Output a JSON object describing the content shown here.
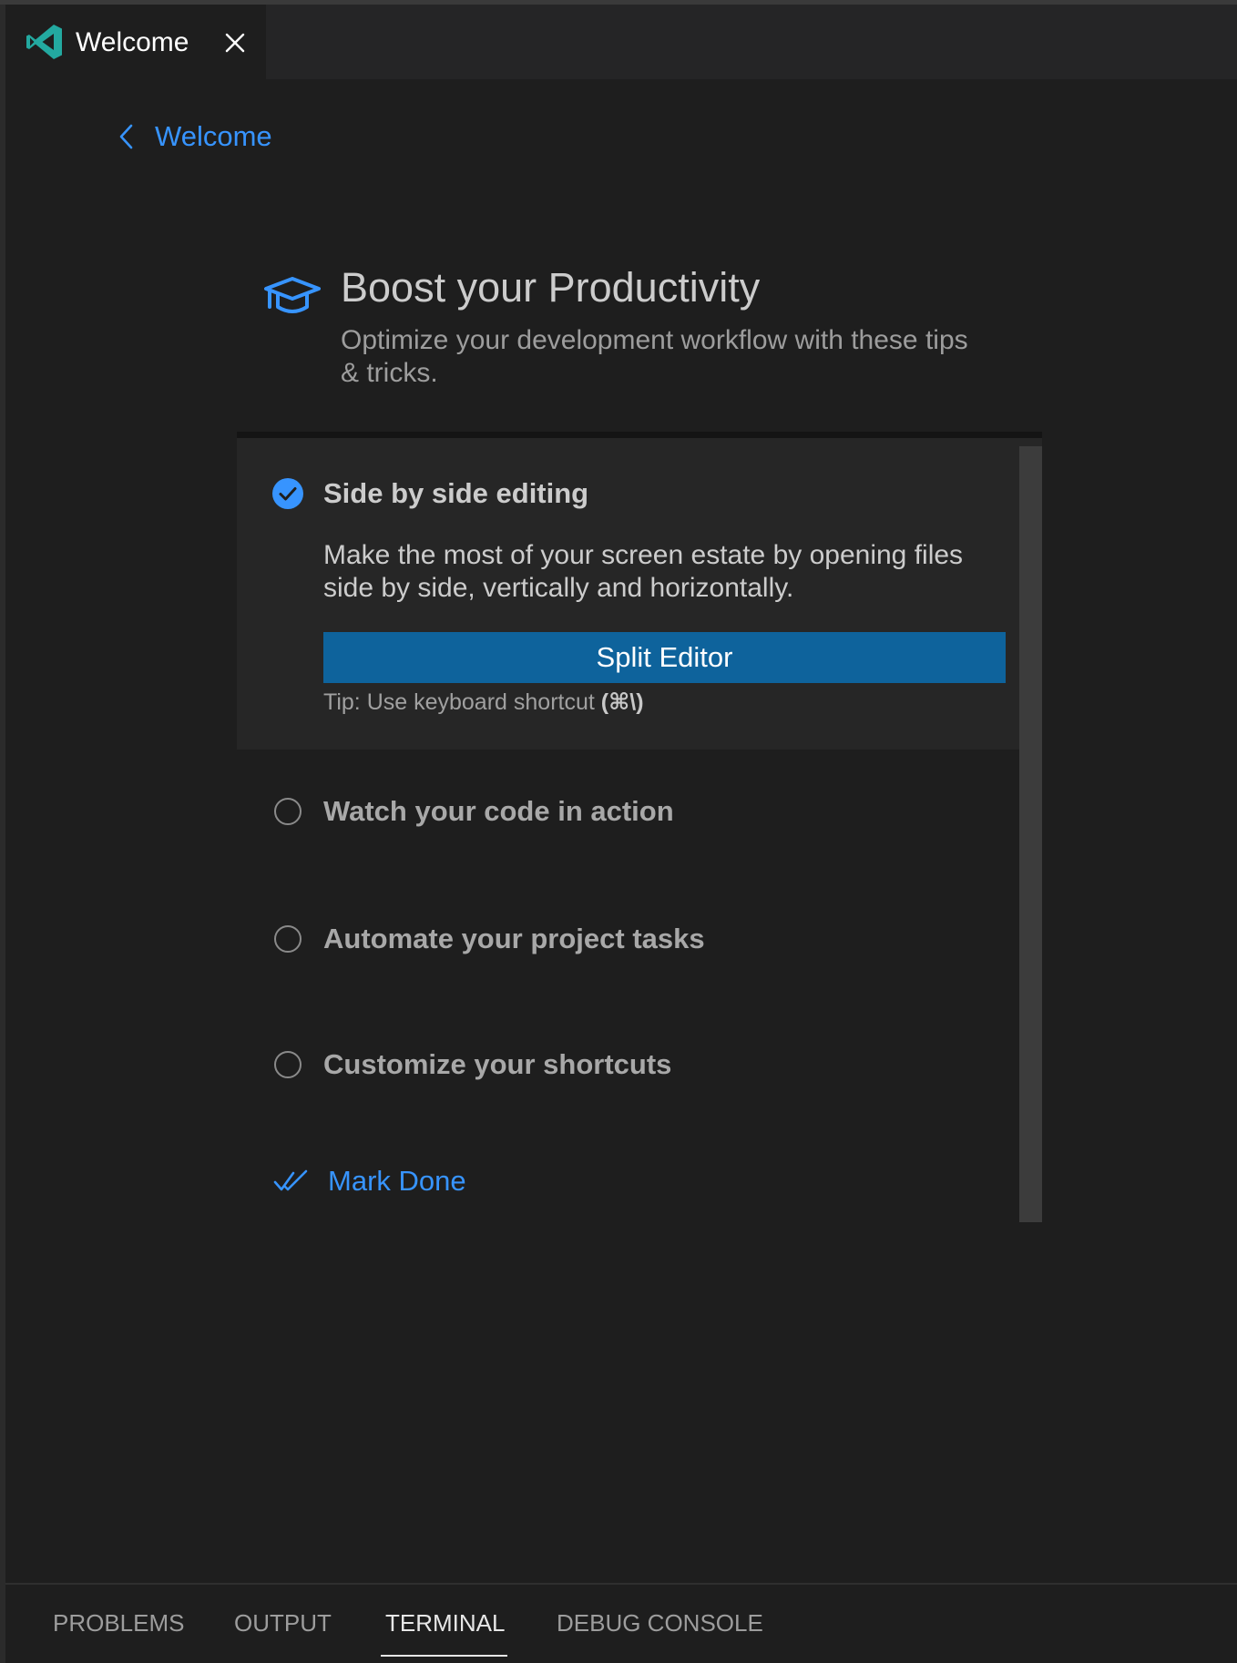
{
  "tab": {
    "label": "Welcome"
  },
  "back": {
    "label": "Welcome"
  },
  "header": {
    "title": "Boost your Productivity",
    "subtitle": "Optimize your development workflow with these tips & tricks."
  },
  "steps": [
    {
      "title": "Side by side editing",
      "done": true,
      "description": "Make the most of your screen estate by opening files side by side, vertically and horizontally.",
      "button_label": "Split Editor",
      "tip_prefix": "Tip: Use keyboard shortcut ",
      "tip_shortcut": "(⌘\\)"
    },
    {
      "title": "Watch your code in action",
      "done": false
    },
    {
      "title": "Automate your project tasks",
      "done": false
    },
    {
      "title": "Customize your shortcuts",
      "done": false
    }
  ],
  "mark_done": {
    "label": "Mark Done"
  },
  "panel": {
    "tabs": [
      "PROBLEMS",
      "OUTPUT",
      "TERMINAL",
      "DEBUG CONSOLE"
    ],
    "active": "TERMINAL"
  },
  "colors": {
    "accent": "#3794ff",
    "button": "#0e639c",
    "logo": "#23a9a0",
    "background": "#1e1e1e"
  },
  "icons": {
    "tab": "vscode-logo-icon",
    "hero": "mortarboard-icon",
    "done": "check-circle-icon",
    "mark_done": "check-all-icon"
  }
}
